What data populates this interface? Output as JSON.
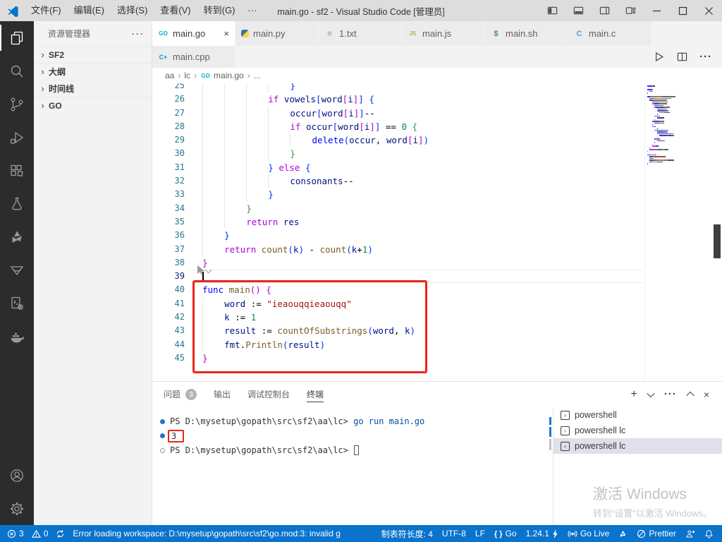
{
  "title_bar": {
    "menus": [
      "文件(F)",
      "编辑(E)",
      "选择(S)",
      "查看(V)",
      "转到(G)",
      "···"
    ],
    "title": "main.go - sf2 - Visual Studio Code [管理员]"
  },
  "activity_bar": {
    "items": [
      "explorer",
      "search",
      "source-control",
      "run-debug",
      "extensions",
      "testing",
      "extension-swirl",
      "extension-triangle",
      "code-runner",
      "docker"
    ],
    "bottom_items": [
      "account",
      "settings"
    ]
  },
  "sidebar": {
    "header": "资源管理器",
    "sections": [
      "SF2",
      "大纲",
      "时间线",
      "GO"
    ]
  },
  "editor": {
    "tabs_row1": [
      {
        "label": "main.go",
        "icon": "go",
        "active": true,
        "close": "×"
      },
      {
        "label": "main.py",
        "icon": "py"
      },
      {
        "label": "1.txt",
        "icon": "txt"
      },
      {
        "label": "main.js",
        "icon": "js"
      },
      {
        "label": "main.sh",
        "icon": "sh"
      },
      {
        "label": "main.c",
        "icon": "c"
      }
    ],
    "tabs_row2": [
      {
        "label": "main.cpp",
        "icon": "cpp"
      }
    ],
    "breadcrumb": [
      {
        "label": "aa"
      },
      {
        "label": "lc"
      },
      {
        "label": "main.go",
        "icon": "go"
      },
      {
        "label": "..."
      }
    ],
    "code_lines": [
      {
        "n": 25,
        "ind": 4,
        "segs": [
          [
            "}",
            "p0"
          ]
        ]
      },
      {
        "n": 26,
        "ind": 3,
        "segs": [
          [
            "if",
            "k"
          ],
          [
            " ",
            "o"
          ],
          [
            "vowels",
            "v"
          ],
          [
            "[",
            "p0"
          ],
          [
            "word",
            "v"
          ],
          [
            "[",
            "pm"
          ],
          [
            "i",
            "v"
          ],
          [
            "]",
            "pm"
          ],
          [
            "]",
            "p0"
          ],
          [
            " ",
            "o"
          ],
          [
            "{",
            "p0"
          ]
        ]
      },
      {
        "n": 27,
        "ind": 4,
        "segs": [
          [
            "occur",
            "v"
          ],
          [
            "[",
            "p0"
          ],
          [
            "word",
            "v"
          ],
          [
            "[",
            "pm"
          ],
          [
            "i",
            "v"
          ],
          [
            "]",
            "pm"
          ],
          [
            "]",
            "p0"
          ],
          [
            "--",
            "o"
          ]
        ]
      },
      {
        "n": 28,
        "ind": 4,
        "segs": [
          [
            "if",
            "k"
          ],
          [
            " ",
            "o"
          ],
          [
            "occur",
            "v"
          ],
          [
            "[",
            "p0"
          ],
          [
            "word",
            "v"
          ],
          [
            "[",
            "pm"
          ],
          [
            "i",
            "v"
          ],
          [
            "]",
            "pm"
          ],
          [
            "]",
            "p0"
          ],
          [
            " == ",
            "o"
          ],
          [
            "0",
            "n"
          ],
          [
            " ",
            "o"
          ],
          [
            "{",
            "p1"
          ]
        ]
      },
      {
        "n": 29,
        "ind": 5,
        "segs": [
          [
            "delete",
            "f"
          ],
          [
            "(",
            "p0"
          ],
          [
            "occur",
            "v"
          ],
          [
            ", ",
            "o"
          ],
          [
            "word",
            "v"
          ],
          [
            "[",
            "pm"
          ],
          [
            "i",
            "v"
          ],
          [
            "]",
            "pm"
          ],
          [
            ")",
            "p0"
          ]
        ]
      },
      {
        "n": 30,
        "ind": 4,
        "segs": [
          [
            "}",
            "p1"
          ]
        ]
      },
      {
        "n": 31,
        "ind": 3,
        "segs": [
          [
            "}",
            "p0"
          ],
          [
            " ",
            "o"
          ],
          [
            "else",
            "k"
          ],
          [
            " ",
            "o"
          ],
          [
            "{",
            "p0"
          ]
        ]
      },
      {
        "n": 32,
        "ind": 4,
        "segs": [
          [
            "consonants",
            "v"
          ],
          [
            "--",
            "o"
          ]
        ]
      },
      {
        "n": 33,
        "ind": 3,
        "segs": [
          [
            "}",
            "p0"
          ]
        ]
      },
      {
        "n": 34,
        "ind": 2,
        "segs": [
          [
            "}",
            "p1"
          ]
        ]
      },
      {
        "n": 35,
        "ind": 2,
        "segs": [
          [
            "return",
            "k"
          ],
          [
            " ",
            "o"
          ],
          [
            "res",
            "v"
          ]
        ]
      },
      {
        "n": 36,
        "ind": 1,
        "segs": [
          [
            "}",
            "p0"
          ]
        ]
      },
      {
        "n": 37,
        "ind": 1,
        "segs": [
          [
            "return",
            "k"
          ],
          [
            " ",
            "o"
          ],
          [
            "count",
            "fn"
          ],
          [
            "(",
            "p0"
          ],
          [
            "k",
            "v"
          ],
          [
            ")",
            "p0"
          ],
          [
            " - ",
            "o"
          ],
          [
            "count",
            "fn"
          ],
          [
            "(",
            "p0"
          ],
          [
            "k",
            "v"
          ],
          [
            "+",
            "o"
          ],
          [
            "1",
            "n"
          ],
          [
            ")",
            "p0"
          ]
        ]
      },
      {
        "n": 38,
        "ind": 0,
        "segs": [
          [
            "}",
            "pm"
          ]
        ]
      },
      {
        "n": 39,
        "ind": 0,
        "segs": []
      },
      {
        "n": 40,
        "ind": 0,
        "segs": [
          [
            "func",
            "f"
          ],
          [
            " ",
            "o"
          ],
          [
            "main",
            "fn"
          ],
          [
            "(",
            "pm"
          ],
          [
            ")",
            "pm"
          ],
          [
            " ",
            "o"
          ],
          [
            "{",
            "pm"
          ]
        ]
      },
      {
        "n": 41,
        "ind": 1,
        "segs": [
          [
            "word",
            "v"
          ],
          [
            " := ",
            "o"
          ],
          [
            "\"ieaouqqieaouqq\"",
            "s"
          ]
        ]
      },
      {
        "n": 42,
        "ind": 1,
        "segs": [
          [
            "k",
            "v"
          ],
          [
            " := ",
            "o"
          ],
          [
            "1",
            "n"
          ]
        ]
      },
      {
        "n": 43,
        "ind": 1,
        "segs": [
          [
            "result",
            "v"
          ],
          [
            " := ",
            "o"
          ],
          [
            "countOfSubstrings",
            "fn"
          ],
          [
            "(",
            "p0"
          ],
          [
            "word",
            "v"
          ],
          [
            ", ",
            "o"
          ],
          [
            "k",
            "v"
          ],
          [
            ")",
            "p0"
          ]
        ]
      },
      {
        "n": 44,
        "ind": 1,
        "segs": [
          [
            "fmt",
            "v"
          ],
          [
            ".",
            "o"
          ],
          [
            "Println",
            "fn"
          ],
          [
            "(",
            "p0"
          ],
          [
            "result",
            "v"
          ],
          [
            ")",
            "p0"
          ]
        ]
      },
      {
        "n": 45,
        "ind": 0,
        "segs": [
          [
            "}",
            "pm"
          ]
        ]
      }
    ],
    "current_line": 39
  },
  "panel": {
    "tabs": [
      {
        "label": "问题",
        "badge": "3"
      },
      {
        "label": "输出"
      },
      {
        "label": "调试控制台"
      },
      {
        "label": "终端",
        "active": true
      }
    ],
    "terminal": {
      "lines": [
        {
          "decoration": "filled",
          "segs": [
            [
              "PS D:\\mysetup\\gopath\\src\\sf2\\aa\\lc> ",
              "t"
            ],
            [
              "go run main.go",
              "cmd"
            ]
          ]
        },
        {
          "decoration": "filled",
          "boxed": "3"
        },
        {
          "decoration": "hollow",
          "segs": [
            [
              "PS D:\\mysetup\\gopath\\src\\sf2\\aa\\lc> ",
              "t"
            ]
          ],
          "cursor": true
        }
      ],
      "list": [
        {
          "label": "powershell"
        },
        {
          "label": "powershell lc"
        },
        {
          "label": "powershell lc",
          "selected": true
        }
      ]
    }
  },
  "watermark": {
    "line1": "激活 Windows",
    "line2": "转到“设置”以激活 Windows。"
  },
  "status_bar": {
    "left": [
      {
        "icon": "error",
        "label": "3"
      },
      {
        "icon": "warn",
        "label": "0"
      },
      {
        "icon": "sync"
      },
      {
        "label": "Error loading workspace: D:\\mysetup\\gopath\\src\\sf2\\go.mod:3: invalid g"
      }
    ],
    "right": [
      {
        "label": "制表符长度: 4"
      },
      {
        "label": "UTF-8"
      },
      {
        "label": "LF"
      },
      {
        "icon": "braces",
        "label": "Go"
      },
      {
        "label": "1.24.1",
        "icon2": "bolt"
      },
      {
        "icon": "broadcast",
        "label": "Go Live"
      },
      {
        "icon": "swirl"
      },
      {
        "icon": "slash",
        "label": "Prettier"
      },
      {
        "icon": "person"
      },
      {
        "icon": "bell"
      }
    ],
    "accent": "#0a73cc",
    "annotation_color": "#e8261d"
  }
}
